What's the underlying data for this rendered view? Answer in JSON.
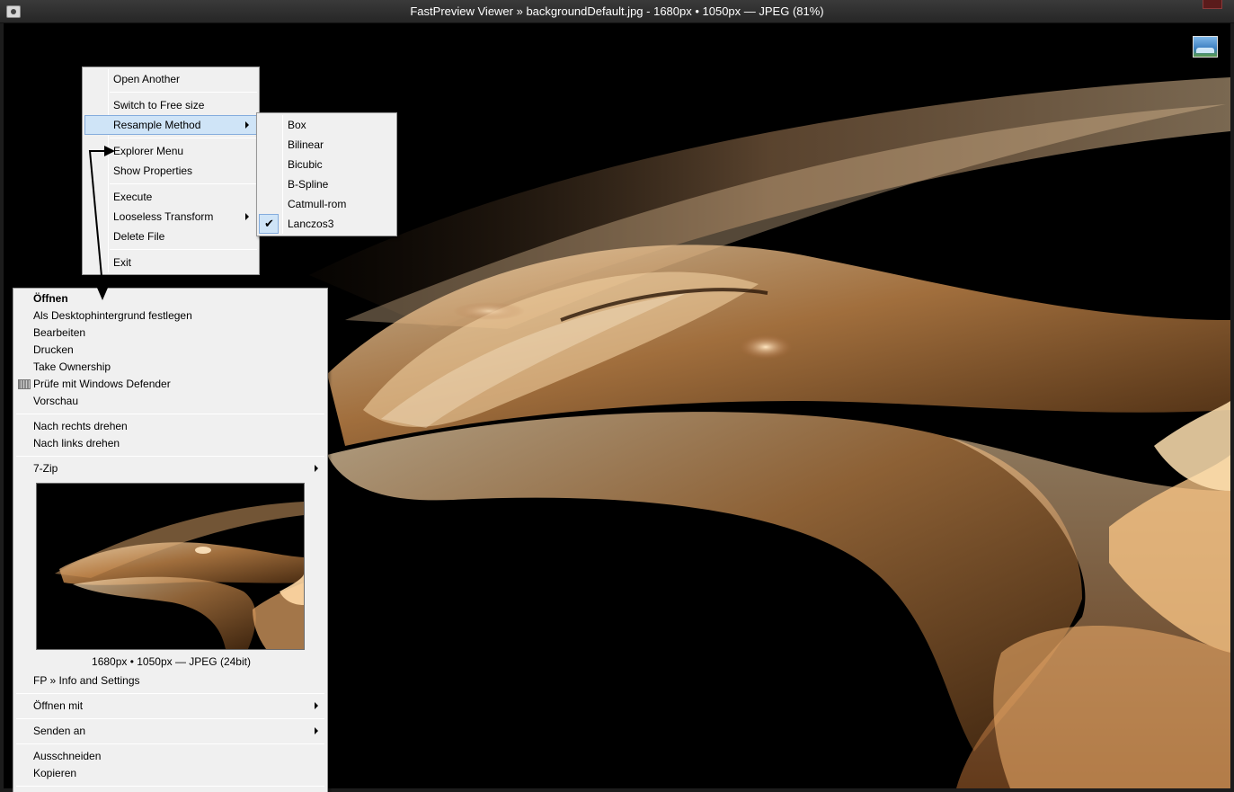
{
  "window": {
    "title": "FastPreview Viewer » backgroundDefault.jpg - 1680px • 1050px — JPEG (81%)"
  },
  "main_menu": {
    "items": [
      {
        "label": "Open Another"
      },
      {
        "label": "Switch to Free size"
      },
      {
        "label": "Resample Method",
        "submenu": true,
        "highlighted": true
      },
      {
        "label": "Explorer Menu"
      },
      {
        "label": "Show Properties"
      },
      {
        "label": "Execute"
      },
      {
        "label": "Looseless Transform",
        "submenu": true
      },
      {
        "label": "Delete File"
      },
      {
        "label": "Exit"
      }
    ]
  },
  "resample_menu": {
    "items": [
      {
        "label": "Box"
      },
      {
        "label": "Bilinear"
      },
      {
        "label": "Bicubic"
      },
      {
        "label": "B-Spline"
      },
      {
        "label": "Catmull-rom"
      },
      {
        "label": "Lanczos3",
        "checked": true
      }
    ],
    "check_icon": "checkmark-icon"
  },
  "explorer_menu": {
    "default_item": "Öffnen",
    "items_group1": [
      {
        "label": "Als Desktophintergrund festlegen"
      },
      {
        "label": "Bearbeiten"
      },
      {
        "label": "Drucken"
      },
      {
        "label": "Take Ownership"
      },
      {
        "label": "Prüfe mit Windows Defender",
        "icon": "windows-defender-icon"
      },
      {
        "label": "Vorschau"
      }
    ],
    "items_group2": [
      {
        "label": "Nach rechts drehen"
      },
      {
        "label": "Nach links drehen"
      }
    ],
    "zip_item": "7-Zip",
    "preview_info": "1680px • 1050px — JPEG (24bit)",
    "fp_item": "FP » Info and Settings",
    "open_with": "Öffnen mit",
    "send_to": "Senden an",
    "cut": "Ausschneiden",
    "copy": "Kopieren"
  },
  "colors": {
    "menu_bg": "#f0f0f0",
    "highlight_bg": "#cfe4f7",
    "highlight_border": "#84acdd",
    "title_bg": "#2e2e2e",
    "image_gold": "#e0a060"
  }
}
